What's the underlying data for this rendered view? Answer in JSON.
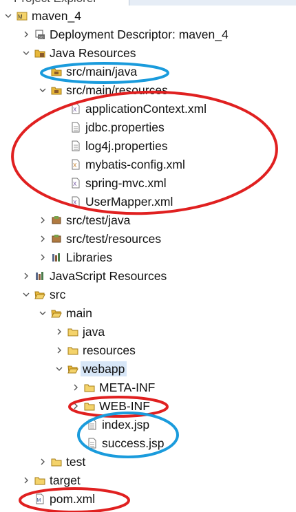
{
  "view": {
    "title": "Project Explorer"
  },
  "tree": {
    "items": [
      {
        "label": "maven_4",
        "icon": "maven-project-icon",
        "twisty": "expanded"
      },
      {
        "label": "Deployment Descriptor: maven_4",
        "icon": "deployment-descriptor-icon",
        "twisty": "collapsed"
      },
      {
        "label": "Java Resources",
        "icon": "java-resources-icon",
        "twisty": "expanded"
      },
      {
        "label": "src/main/java",
        "icon": "source-folder-icon",
        "twisty": "none"
      },
      {
        "label": "src/main/resources",
        "icon": "source-folder-icon",
        "twisty": "expanded"
      },
      {
        "label": "applicationContext.xml",
        "icon": "xml-file-icon",
        "twisty": "none"
      },
      {
        "label": "jdbc.properties",
        "icon": "properties-file-icon",
        "twisty": "none"
      },
      {
        "label": "log4j.properties",
        "icon": "properties-file-icon",
        "twisty": "none"
      },
      {
        "label": "mybatis-config.xml",
        "icon": "xml-file-icon",
        "twisty": "none"
      },
      {
        "label": "spring-mvc.xml",
        "icon": "xml-file-icon",
        "twisty": "none"
      },
      {
        "label": "UserMapper.xml",
        "icon": "xml-file-icon",
        "twisty": "none"
      },
      {
        "label": "src/test/java",
        "icon": "package-folder-icon",
        "twisty": "collapsed"
      },
      {
        "label": "src/test/resources",
        "icon": "package-folder-icon",
        "twisty": "collapsed"
      },
      {
        "label": "Libraries",
        "icon": "libraries-icon",
        "twisty": "collapsed"
      },
      {
        "label": "JavaScript Resources",
        "icon": "javascript-resources-icon",
        "twisty": "collapsed"
      },
      {
        "label": "src",
        "icon": "folder-icon",
        "twisty": "expanded"
      },
      {
        "label": "main",
        "icon": "folder-icon",
        "twisty": "expanded"
      },
      {
        "label": "java",
        "icon": "folder-icon",
        "twisty": "collapsed"
      },
      {
        "label": "resources",
        "icon": "folder-icon",
        "twisty": "collapsed"
      },
      {
        "label": "webapp",
        "icon": "folder-open-icon",
        "twisty": "expanded"
      },
      {
        "label": "META-INF",
        "icon": "folder-icon",
        "twisty": "collapsed"
      },
      {
        "label": "WEB-INF",
        "icon": "folder-icon",
        "twisty": "collapsed"
      },
      {
        "label": "index.jsp",
        "icon": "jsp-file-icon",
        "twisty": "none"
      },
      {
        "label": "success.jsp",
        "icon": "jsp-file-icon",
        "twisty": "none"
      },
      {
        "label": "test",
        "icon": "folder-icon",
        "twisty": "collapsed"
      },
      {
        "label": "target",
        "icon": "folder-icon",
        "twisty": "collapsed"
      },
      {
        "label": "pom.xml",
        "icon": "maven-pom-icon",
        "twisty": "none"
      }
    ]
  },
  "colors": {
    "red_annotation": "#e02020",
    "blue_annotation": "#1a9bdc",
    "selection": "#d7e6f7",
    "folder": "#e8b83a"
  }
}
